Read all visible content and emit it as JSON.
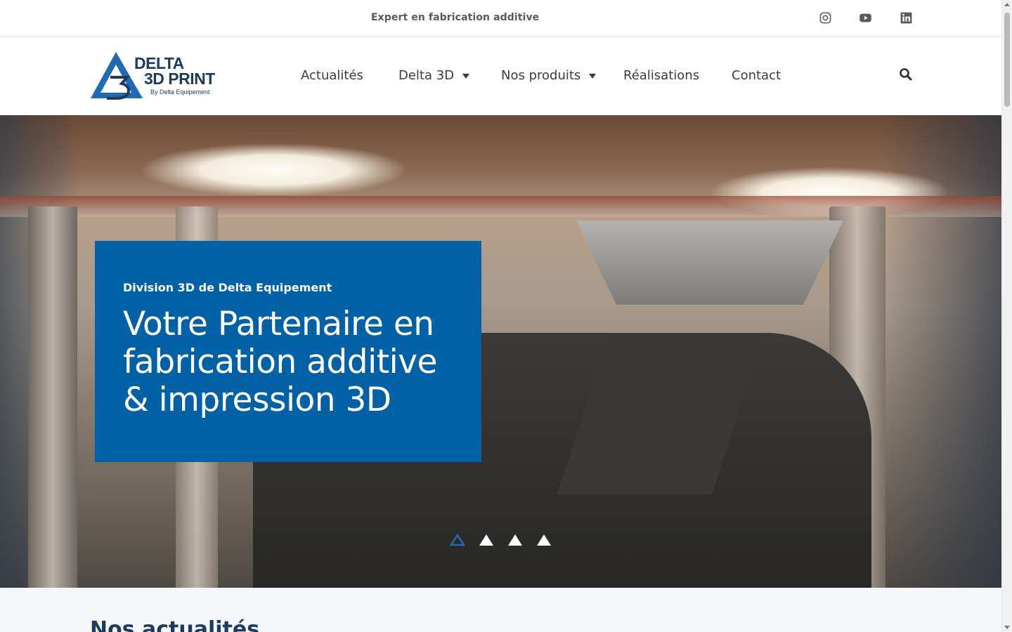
{
  "topbar": {
    "tagline": "Expert en fabrication additive",
    "social": [
      {
        "icon": "instagram-icon"
      },
      {
        "icon": "youtube-icon"
      },
      {
        "icon": "linkedin-icon"
      }
    ]
  },
  "header": {
    "logo": {
      "line1": "DELTA",
      "line2": "3D PRINT",
      "line3": "By Delta Equipement",
      "colors": {
        "primary": "#1f3a5f",
        "accent": "#1e6ab4"
      }
    },
    "nav": [
      {
        "label": "Actualités",
        "has_dropdown": false
      },
      {
        "label": "Delta 3D",
        "has_dropdown": true
      },
      {
        "label": "Nos produits",
        "has_dropdown": true
      },
      {
        "label": "Réalisations",
        "has_dropdown": false
      },
      {
        "label": "Contact",
        "has_dropdown": false
      }
    ],
    "search_icon": "search-icon"
  },
  "hero": {
    "eyebrow": "Division 3D de Delta Equipement",
    "title": "Votre Partenaire en fabrication additive & impression 3D",
    "card_color": "#0061a7",
    "slides": {
      "count": 4,
      "active": 1
    }
  },
  "section": {
    "title": "Nos actualités"
  }
}
